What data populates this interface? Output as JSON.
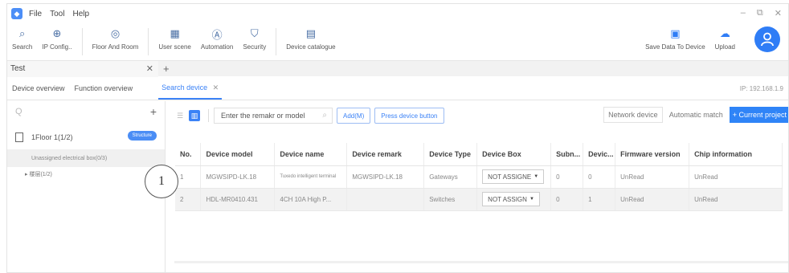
{
  "menubar": {
    "items": [
      "File",
      "Tool",
      "Help"
    ]
  },
  "window_controls": [
    "–",
    "⧉",
    "✕"
  ],
  "toolbar": {
    "search": "Search",
    "ip_config": "IP Config..",
    "floor_room": "Floor And Room",
    "user_scene": "User scene",
    "automation": "Automation",
    "security": "Security",
    "device_catalogue": "Device catalogue",
    "save_data": "Save Data To Device",
    "upload": "Upload"
  },
  "project_tab": {
    "label": "Test",
    "close": "✕",
    "add": "+"
  },
  "page_tabs": {
    "device_overview": "Device overview",
    "function_overview": "Function overview",
    "search_device": "Search device",
    "close": "✕",
    "ip": "IP: 192.168.1.9"
  },
  "left": {
    "search_placeholder": "Q",
    "add": "+",
    "floor_label": "1Floor 1(1/2)",
    "structure_badge": "Structure",
    "unassigned": "Unassigned electrical box(0/3)",
    "tree_item": "▸  楼层(1/2)"
  },
  "filter": {
    "search_placeholder": "Enter the remakr or model",
    "add": "Add(M)",
    "press_button": "Press device button",
    "network_device": "Network device",
    "automatic_match": "Automatic match",
    "current_project": "+ Current project"
  },
  "table": {
    "headers": [
      "No.",
      "Device model",
      "Device name",
      "Device remark",
      "Device Type",
      "Device Box",
      "Subn...",
      "Devic...",
      "Firmware version",
      "Chip information"
    ],
    "rows": [
      {
        "no": "1",
        "model": "MGWSIPD-LK.18",
        "name": "Tuxedo intelligent terminal",
        "remark": "MGWSIPD-LK.18",
        "type": "Gateways",
        "box": "NOT ASSIGNE",
        "subnet": "0",
        "device": "0",
        "firmware": "UnRead",
        "chip": "UnRead"
      },
      {
        "no": "2",
        "model": "HDL-MR0410.431",
        "name": "4CH 10A High P...",
        "remark": "",
        "type": "Switches",
        "box": "NOT ASSIGN",
        "subnet": "0",
        "device": "1",
        "firmware": "UnRead",
        "chip": "UnRead"
      }
    ]
  },
  "callout": "1",
  "colors": {
    "accent": "#3b82f6",
    "structure": "#4a8df5",
    "avatar": "#2f7df6"
  }
}
